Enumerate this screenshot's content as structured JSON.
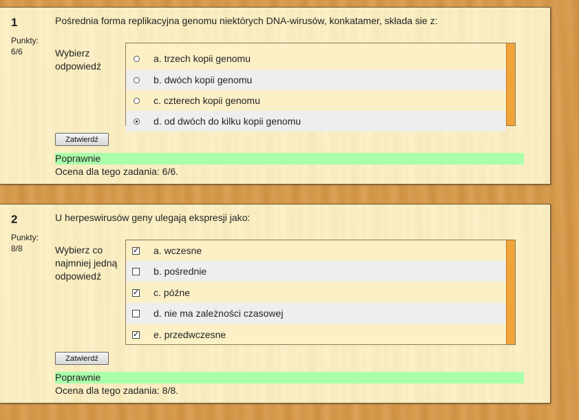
{
  "questions": [
    {
      "number": "1",
      "points_label": "Punkty:",
      "points_value": "6/6",
      "text": "Pośrednia forma replikacyjna genomu niektórych DNA-wirusów, konkatamer, składa sie z:",
      "prompt": "Wybierz odpowiedź",
      "answers": [
        {
          "label": "a. trzech kopii genomu",
          "selected": false
        },
        {
          "label": "b. dwóch kopii genomu",
          "selected": false
        },
        {
          "label": "c. czterech kopii genomu",
          "selected": false
        },
        {
          "label": "d. od dwóch do kilku kopii genomu",
          "selected": true
        }
      ],
      "submit_label": "Zatwierdź",
      "feedback": "Poprawnie",
      "score": "Ocena dla tego zadania: 6/6."
    },
    {
      "number": "2",
      "points_label": "Punkty:",
      "points_value": "8/8",
      "text": "U herpeswirusów geny ulegają ekspresji jako:",
      "prompt": "Wybierz co najmniej jedną odpowiedź",
      "answers": [
        {
          "label": "a. wczesne",
          "selected": true
        },
        {
          "label": "b. pośrednie",
          "selected": false
        },
        {
          "label": "c. późne",
          "selected": true
        },
        {
          "label": "d. nie ma zależności czasowej",
          "selected": false
        },
        {
          "label": "e. przedwczesne",
          "selected": true
        }
      ],
      "submit_label": "Zatwierdź",
      "feedback": "Poprawnie",
      "score": "Ocena dla tego zadania: 8/8."
    }
  ],
  "colors": {
    "panel": "#fbf0c6",
    "feedback_bg": "#aaffaa",
    "scrollbar": "#f0a43a",
    "alt_row": "#eeeeee"
  }
}
